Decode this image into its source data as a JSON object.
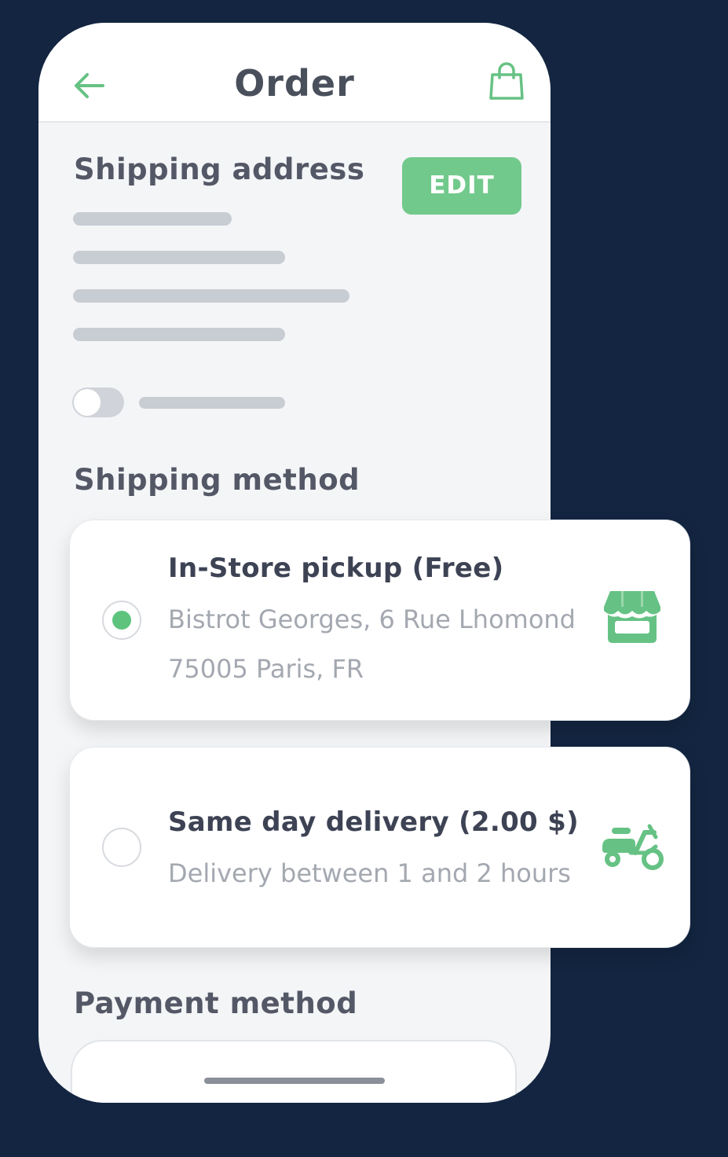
{
  "header": {
    "title": "Order"
  },
  "shipping_address": {
    "title": "Shipping address",
    "edit_label": "EDIT",
    "toggle_on": false
  },
  "shipping_method": {
    "title": "Shipping method",
    "options": [
      {
        "title": "In-Store pickup (Free)",
        "lines": [
          "Bistrot Georges, 6 Rue Lhomond",
          "75005 Paris, FR"
        ],
        "selected": true,
        "icon": "store-icon"
      },
      {
        "title": "Same day delivery (2.00 $)",
        "lines": [
          "Delivery between 1 and 2 hours"
        ],
        "selected": false,
        "icon": "scooter-icon"
      }
    ]
  },
  "payment_method": {
    "title": "Payment method"
  },
  "colors": {
    "background": "#132540",
    "accent": "#72c98c",
    "radio_selected": "#5ec47d",
    "title_text": "#4a4f5c"
  }
}
